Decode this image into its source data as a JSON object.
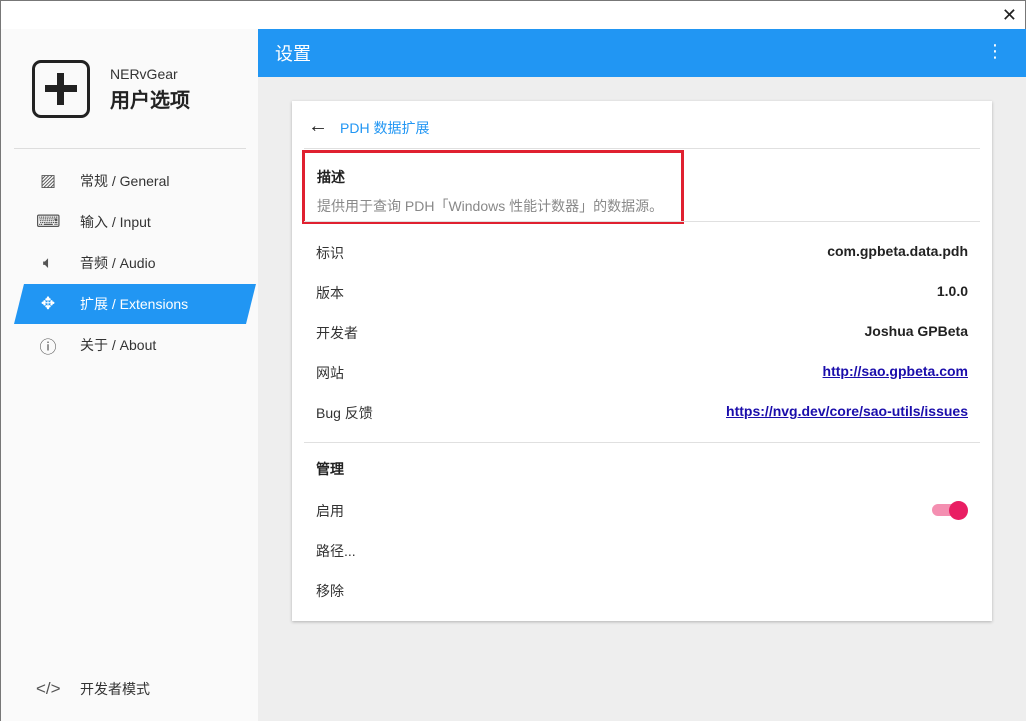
{
  "window": {
    "close_icon": "close-icon"
  },
  "sidebar": {
    "brand": "NERvGear",
    "title": "用户选项",
    "items": [
      {
        "label": "常规 / General",
        "icon": "image-icon"
      },
      {
        "label": "输入 / Input",
        "icon": "keyboard-icon"
      },
      {
        "label": "音频 / Audio",
        "icon": "speaker-icon"
      },
      {
        "label": "扩展 / Extensions",
        "icon": "puzzle-icon"
      },
      {
        "label": "关于 / About",
        "icon": "info-icon"
      }
    ],
    "dev_mode": "开发者模式"
  },
  "header": {
    "title": "设置"
  },
  "card": {
    "title": "PDH 数据扩展",
    "description_heading": "描述",
    "description": "提供用于查询 PDH「Windows 性能计数器」的数据源。",
    "fields": [
      {
        "label": "标识",
        "value": "com.gpbeta.data.pdh"
      },
      {
        "label": "版本",
        "value": "1.0.0"
      },
      {
        "label": "开发者",
        "value": "Joshua GPBeta"
      },
      {
        "label": "网站",
        "value": "http://sao.gpbeta.com"
      },
      {
        "label": "Bug 反馈",
        "value": "https://nvg.dev/core/sao-utils/issues"
      }
    ],
    "manage_heading": "管理",
    "enable_label": "启用",
    "enabled": true,
    "path_label": "路径...",
    "remove_label": "移除"
  },
  "colors": {
    "accent": "#2196f3",
    "toggle": "#e91e63",
    "highlight": "#e02030"
  }
}
